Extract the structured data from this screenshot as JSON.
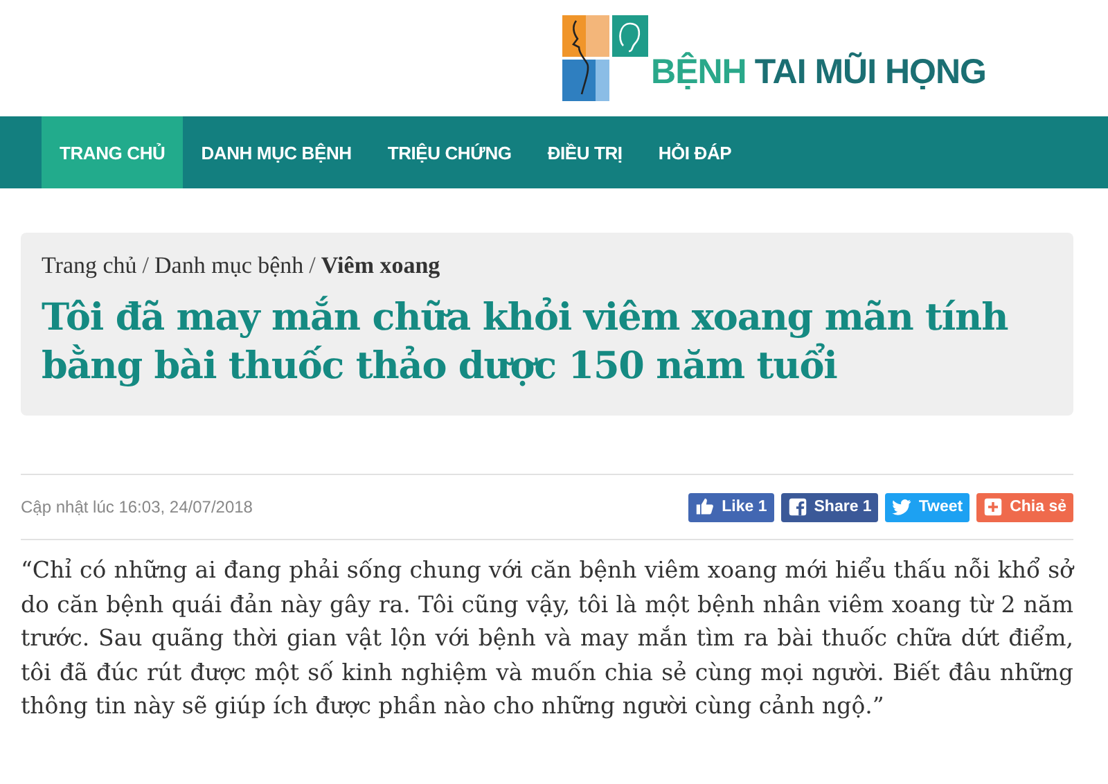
{
  "logo": {
    "text_1": "BỆNH",
    "text_2": "TAI MŨI HỌNG"
  },
  "nav": [
    {
      "label": "TRANG CHỦ",
      "selected": true
    },
    {
      "label": "DANH MỤC BỆNH",
      "selected": false
    },
    {
      "label": "TRIỆU CHỨNG",
      "selected": false
    },
    {
      "label": "ĐIỀU TRỊ",
      "selected": false
    },
    {
      "label": "HỎI ĐÁP",
      "selected": false
    }
  ],
  "breadcrumb_separator": "/",
  "breadcrumb": [
    {
      "label": "Trang chủ",
      "current": false
    },
    {
      "label": "Danh mục bệnh",
      "current": false
    },
    {
      "label": "Viêm xoang",
      "current": true
    }
  ],
  "title": "Tôi đã may mắn chữa khỏi viêm xoang mãn tính bằng bài thuốc thảo dược 150 năm tuổi",
  "updated": "Cập nhật lúc 16:03, 24/07/2018",
  "share_buttons": [
    {
      "kind": "like",
      "label": "Like 1",
      "color": "#4267b2"
    },
    {
      "kind": "share",
      "label": "Share 1",
      "color": "#3b5998"
    },
    {
      "kind": "tweet",
      "label": "Tweet",
      "color": "#1da1f2"
    },
    {
      "kind": "plus",
      "label": "Chia sẻ",
      "color": "#ef6a4c"
    }
  ],
  "body": "“Chỉ có những ai đang phải sống chung với căn bệnh viêm xoang mới hiểu thấu nỗi khổ sở do căn bệnh quái đản này gây ra. Tôi cũng vậy, tôi là một bệnh nhân viêm xoang từ 2 năm trước. Sau quãng thời gian vật lộn với bệnh và may mắn tìm ra bài thuốc chữa dứt điểm, tôi đã đúc rút được một số kinh nghiệm và muốn chia sẻ cùng mọi người. Biết đâu những thông tin này sẽ giúp ích được phần nào cho những người cùng cảnh ngộ.”"
}
